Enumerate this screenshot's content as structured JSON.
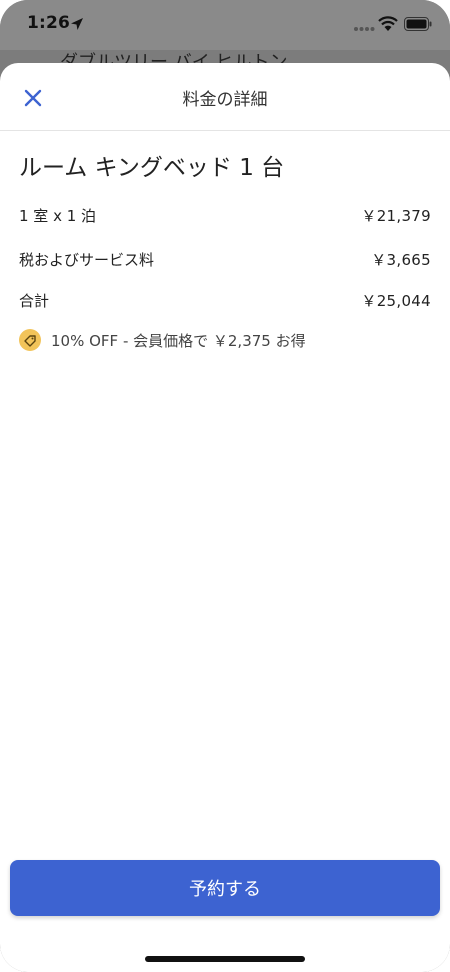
{
  "status_bar": {
    "time": "1:26"
  },
  "background_page": {
    "title": "ダブルツリー バイ ヒルトン"
  },
  "sheet": {
    "title": "料金の詳細",
    "room_title": "ルーム キングベッド 1 台",
    "rows": [
      {
        "label": "1 室 x 1 泊",
        "value": "￥21,379"
      },
      {
        "label": "税およびサービス料",
        "value": "￥3,665"
      },
      {
        "label": "合計",
        "value": "￥25,044"
      }
    ],
    "discount_text": "10% OFF - 会員価格で ￥2,375 お得",
    "reserve_button_label": "予約する"
  },
  "icons": {
    "close": "close-icon",
    "tag": "price-tag-icon"
  },
  "colors": {
    "accent": "#3d63d1",
    "tag_badge": "#f2c45a"
  }
}
